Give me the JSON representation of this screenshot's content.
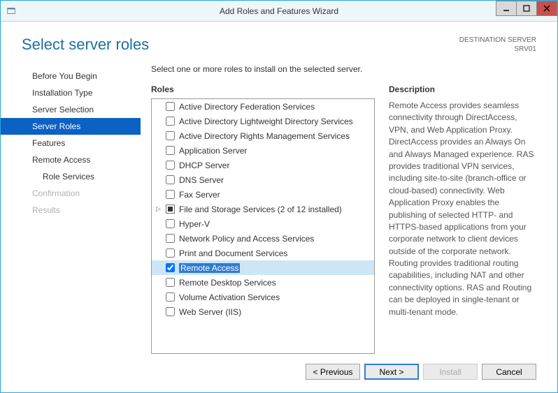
{
  "window": {
    "title": "Add Roles and Features Wizard"
  },
  "header": {
    "title": "Select server roles",
    "dest_label": "DESTINATION SERVER",
    "dest_value": "SRV01"
  },
  "sidebar": {
    "steps": [
      {
        "label": "Before You Begin",
        "state": "normal"
      },
      {
        "label": "Installation Type",
        "state": "normal"
      },
      {
        "label": "Server Selection",
        "state": "normal"
      },
      {
        "label": "Server Roles",
        "state": "selected"
      },
      {
        "label": "Features",
        "state": "normal"
      },
      {
        "label": "Remote Access",
        "state": "normal"
      },
      {
        "label": "Role Services",
        "state": "normal",
        "sub": true
      },
      {
        "label": "Confirmation",
        "state": "disabled"
      },
      {
        "label": "Results",
        "state": "disabled"
      }
    ]
  },
  "content": {
    "instruction": "Select one or more roles to install on the selected server.",
    "roles_label": "Roles",
    "desc_label": "Description",
    "roles": [
      {
        "label": "Active Directory Federation Services",
        "checked": false
      },
      {
        "label": "Active Directory Lightweight Directory Services",
        "checked": false
      },
      {
        "label": "Active Directory Rights Management Services",
        "checked": false
      },
      {
        "label": "Application Server",
        "checked": false
      },
      {
        "label": "DHCP Server",
        "checked": false
      },
      {
        "label": "DNS Server",
        "checked": false
      },
      {
        "label": "Fax Server",
        "checked": false
      },
      {
        "label": "File and Storage Services (2 of 12 installed)",
        "checked": "partial",
        "expandable": true
      },
      {
        "label": "Hyper-V",
        "checked": false
      },
      {
        "label": "Network Policy and Access Services",
        "checked": false
      },
      {
        "label": "Print and Document Services",
        "checked": false
      },
      {
        "label": "Remote Access",
        "checked": true,
        "highlighted": true
      },
      {
        "label": "Remote Desktop Services",
        "checked": false
      },
      {
        "label": "Volume Activation Services",
        "checked": false
      },
      {
        "label": "Web Server (IIS)",
        "checked": false
      }
    ],
    "description": "Remote Access provides seamless connectivity through DirectAccess, VPN, and Web Application Proxy. DirectAccess provides an Always On and Always Managed experience. RAS provides traditional VPN services, including site-to-site (branch-office or cloud-based) connectivity. Web Application Proxy enables the publishing of selected HTTP- and HTTPS-based applications from your corporate network to client devices outside of the corporate network. Routing provides traditional routing capabilities, including NAT and other connectivity options. RAS and Routing can be deployed in single-tenant or multi-tenant mode."
  },
  "footer": {
    "previous": "< Previous",
    "next": "Next >",
    "install": "Install",
    "cancel": "Cancel"
  }
}
